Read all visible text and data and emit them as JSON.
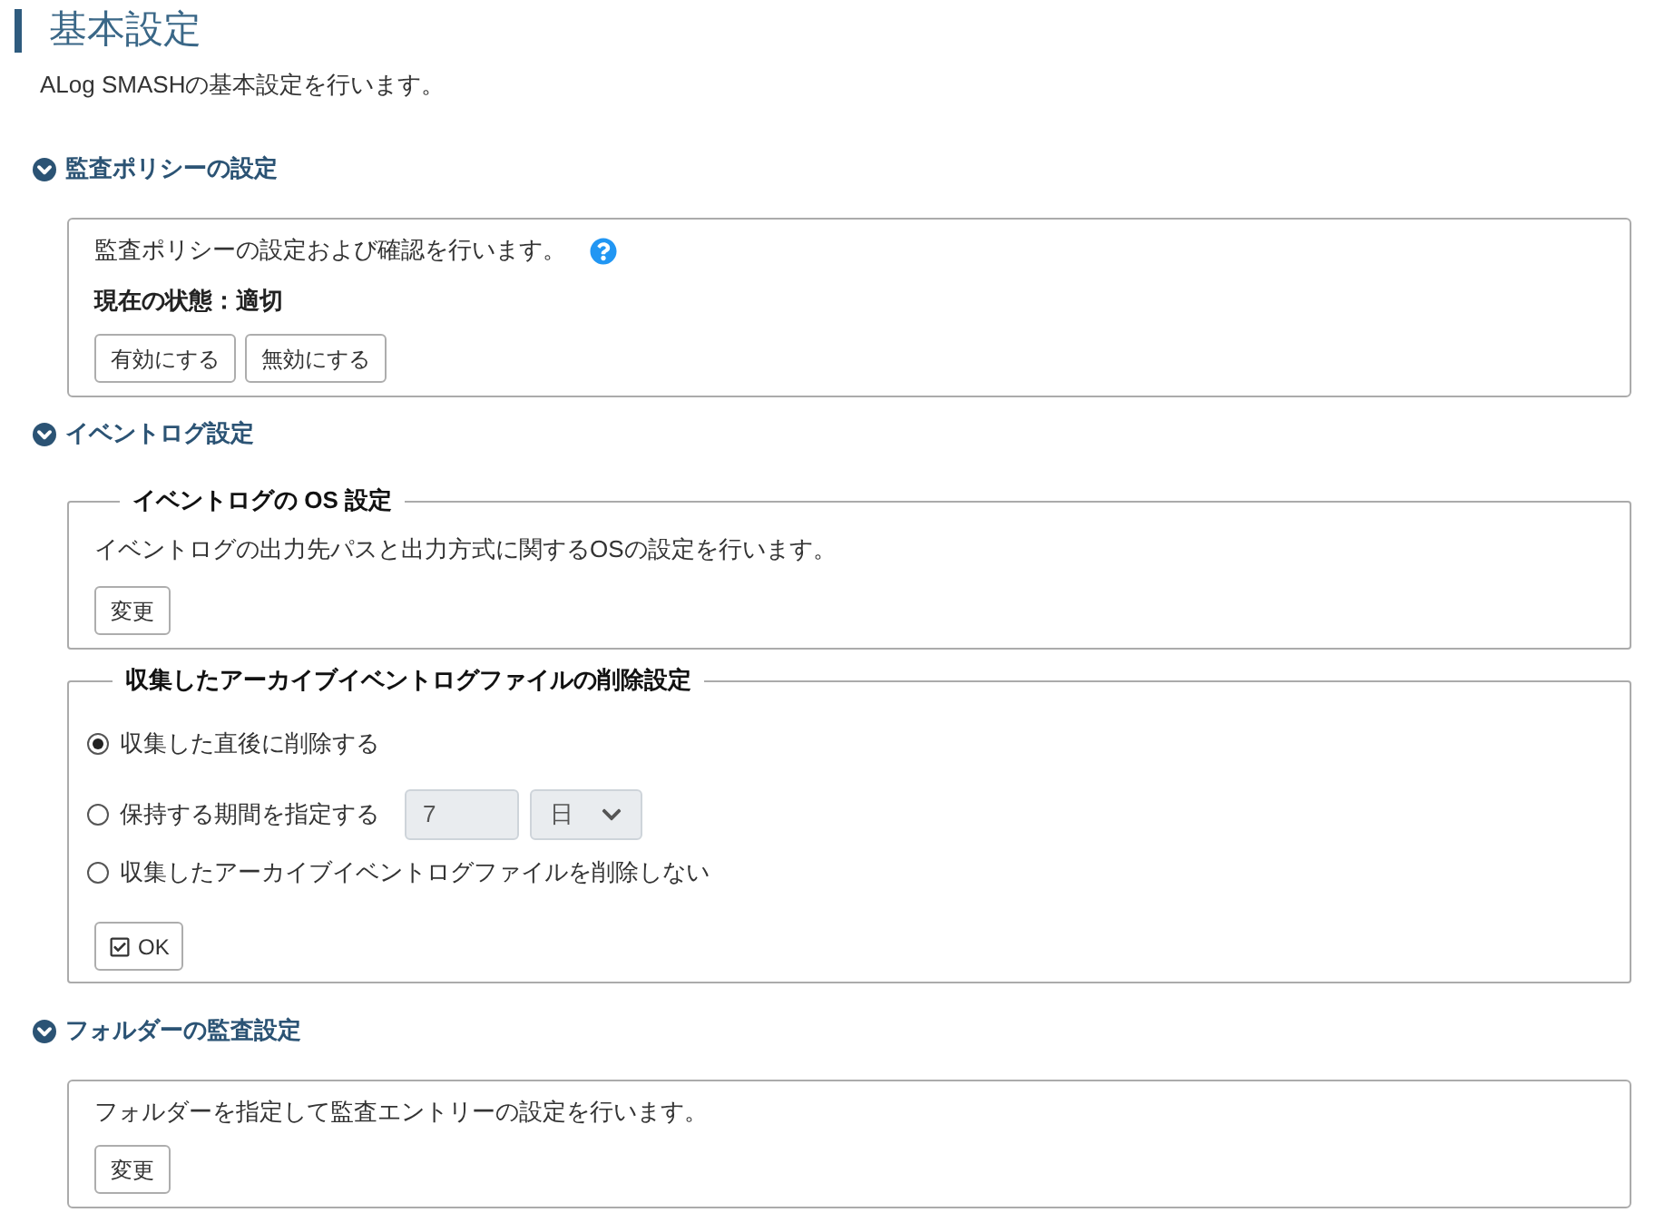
{
  "header": {
    "title": "基本設定",
    "description": "ALog SMASHの基本設定を行います。"
  },
  "sections": [
    {
      "title": "監査ポリシーの設定",
      "expanded": true,
      "blocks": [
        {
          "kind": "panel",
          "text": "監査ポリシーの設定および確認を行います。",
          "help": true,
          "status": "現在の状態：適切",
          "buttons": [
            "有効にする",
            "無効にする"
          ]
        }
      ]
    },
    {
      "title": "イベントログ設定",
      "expanded": true,
      "blocks": [
        {
          "kind": "fieldset",
          "legend": "イベントログの OS 設定",
          "text": "イベントログの出力先パスと出力方式に関するOSの設定を行います。",
          "buttons": [
            "変更"
          ]
        },
        {
          "kind": "options",
          "legend": "収集したアーカイブイベントログファイルの削除設定",
          "options": [
            {
              "label": "収集した直後に削除する",
              "selected": true
            },
            {
              "label": "保持する期間を指定する",
              "selected": false,
              "period": {
                "value": "7",
                "unit": "日",
                "disabled": true
              }
            },
            {
              "label": "収集したアーカイブイベントログファイルを削除しない",
              "selected": false
            }
          ],
          "submit": "OK"
        }
      ]
    },
    {
      "title": "フォルダーの監査設定",
      "expanded": true,
      "blocks": [
        {
          "kind": "panel",
          "text": "フォルダーを指定して監査エントリーの設定を行います。",
          "buttons": [
            "変更"
          ]
        }
      ]
    }
  ]
}
